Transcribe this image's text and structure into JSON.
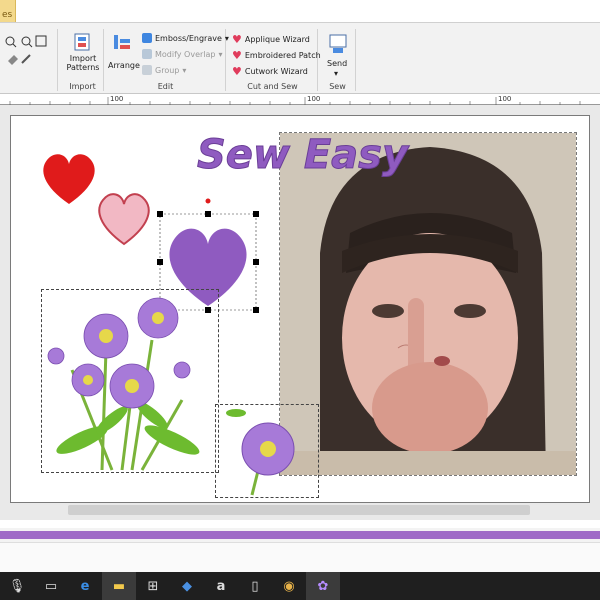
{
  "app": {
    "tab_label": "es"
  },
  "ribbon": {
    "import_group": {
      "label": "Import",
      "import_patterns_line1": "Import",
      "import_patterns_line2": "Patterns"
    },
    "edit_group": {
      "label": "Edit",
      "arrange": "Arrange",
      "emboss_engrave": "Emboss/Engrave",
      "modify_overlap": "Modify Overlap",
      "group": "Group"
    },
    "cut_and_sew_group": {
      "label": "Cut and Sew",
      "applique_wizard": "Applique Wizard",
      "embroidered_patch": "Embroidered Patch",
      "cutwork_wizard": "Cutwork Wizard"
    },
    "sew_group": {
      "label": "Sew",
      "send": "Send"
    }
  },
  "ruler": {
    "marks": [
      "100",
      "100",
      "100"
    ]
  },
  "canvas": {
    "title_text": "Sew  Easy"
  },
  "colors": {
    "purple": "#8f5bc0",
    "red_heart": "#e01b1b",
    "pink_heart": "#f2b8c4",
    "accent_bar": "#9f6bc7"
  }
}
